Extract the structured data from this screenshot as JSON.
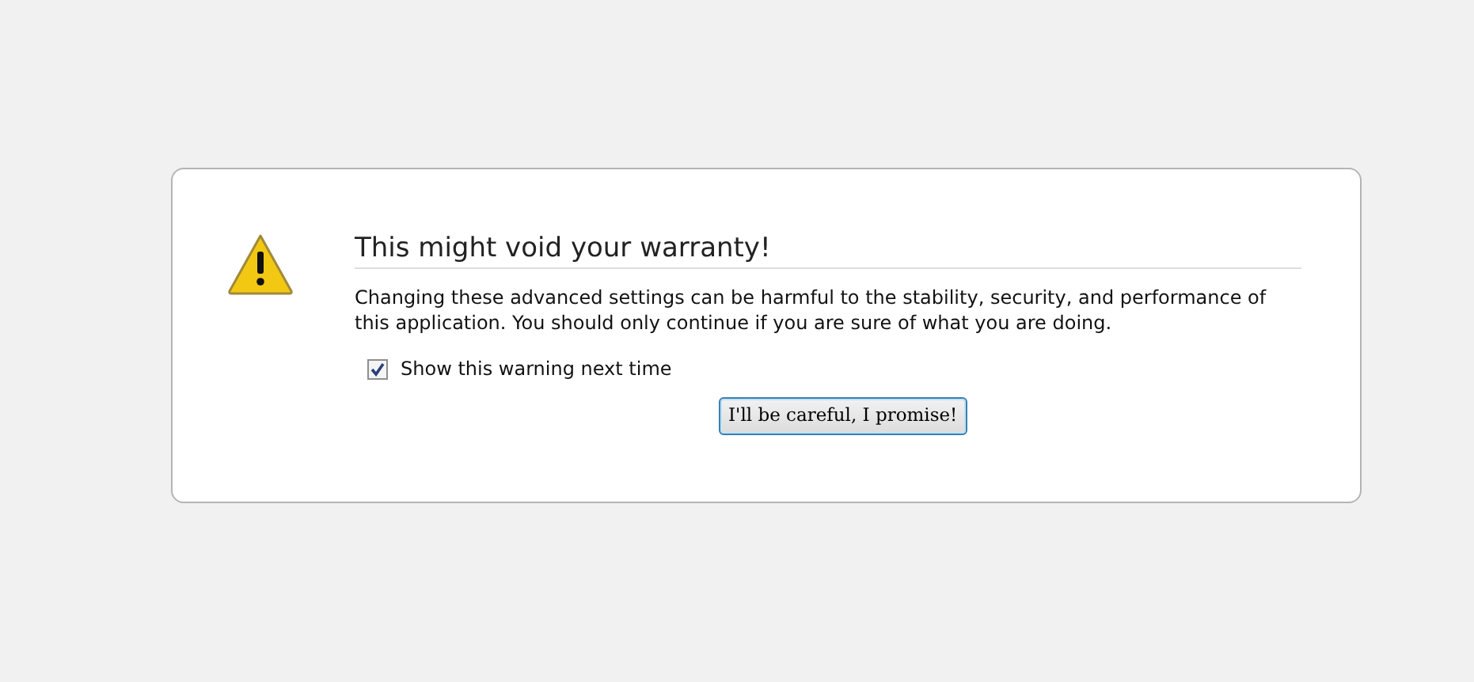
{
  "dialog": {
    "title": "This might void your warranty!",
    "message": "Changing these advanced settings can be harmful to the stability, security, and performance of this application. You should only continue if you are sure of what you are doing.",
    "checkbox": {
      "label": "Show this warning next time",
      "checked": true
    },
    "button": "I'll be careful, I promise!"
  }
}
